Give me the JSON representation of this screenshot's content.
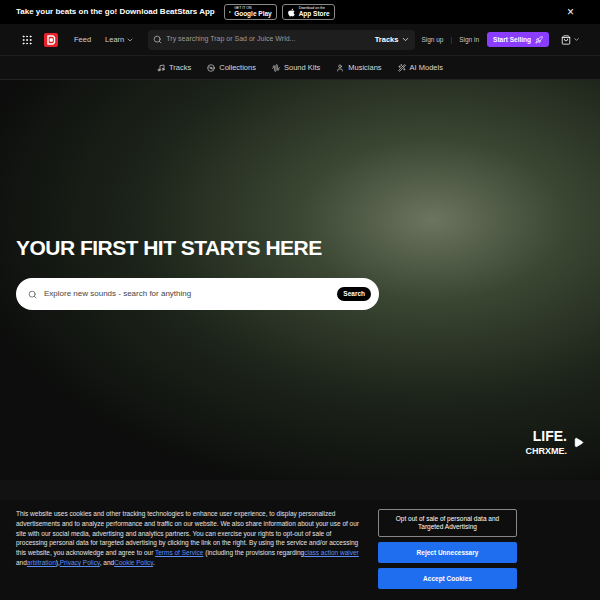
{
  "banner": {
    "text": "Take your beats on the go! Download BeatStars App",
    "badges": [
      {
        "small": "GET IT ON",
        "label": "Google Play",
        "store": "google"
      },
      {
        "small": "Download on the",
        "label": "App Store",
        "store": "apple"
      }
    ],
    "close": "×"
  },
  "nav": {
    "links": [
      {
        "label": "Feed",
        "dropdown": false
      },
      {
        "label": "Learn",
        "dropdown": true
      }
    ],
    "search": {
      "placeholder": "Try searching Trap or Sad or Juice Wrld...",
      "scope": "Tracks"
    },
    "auth": [
      "Sign up",
      "Sign in"
    ],
    "separator": "|",
    "cta": "Start Selling"
  },
  "subnav": [
    {
      "label": "Tracks"
    },
    {
      "label": "Collections"
    },
    {
      "label": "Sound Kits"
    },
    {
      "label": "Musicians"
    },
    {
      "label": "AI Models"
    }
  ],
  "hero": {
    "title": "YOUR FIRST HIT STARTS HERE",
    "search": {
      "placeholder": "Explore new sounds - search for anything",
      "button": "Search"
    },
    "track": {
      "title": "LIFE.",
      "artist": "CHRXME."
    }
  },
  "cookies": {
    "segments": [
      {
        "text": "This website uses cookies and other tracking technologies to enhance user experience, to display personalized advertisements and to analyze performance and traffic on our website. We also share information about your use of our site with our social media, advertising and analytics partners. You can exercise your rights to opt-out of sale of processing personal data for targeted advertising by clicking the link on the right. By using the service and/or accessing this website, you acknowledge and agree to our ",
        "link": false
      },
      {
        "text": "Terms of Service",
        "link": true
      },
      {
        "text": " (including the provisions regarding",
        "link": false
      },
      {
        "text": "class action waiver",
        "link": true
      },
      {
        "text": " and",
        "link": false
      },
      {
        "text": "arbitration",
        "link": true
      },
      {
        "text": "),",
        "link": false
      },
      {
        "text": "Privacy Policy",
        "link": true
      },
      {
        "text": ", and",
        "link": false
      },
      {
        "text": "Cookie Policy",
        "link": true
      },
      {
        "text": ".",
        "link": false
      }
    ],
    "buttons": [
      {
        "label": "Opt out of sale of personal data and Targeted Advertising",
        "kind": "outline"
      },
      {
        "label": "Reject Unnecessary",
        "kind": "primary"
      },
      {
        "label": "Accept Cookies",
        "kind": "primary"
      }
    ]
  }
}
